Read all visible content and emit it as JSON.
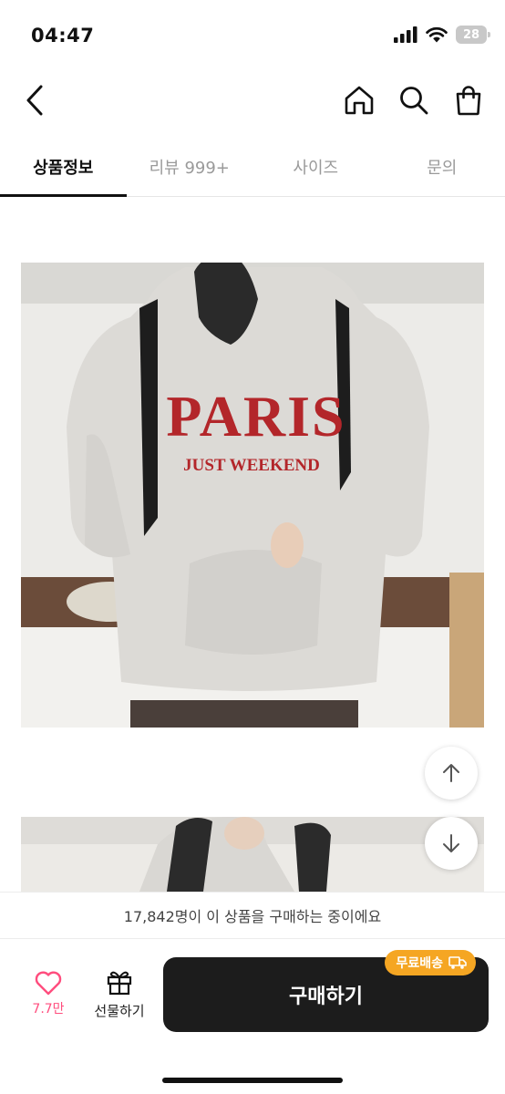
{
  "status_bar": {
    "time": "04:47",
    "battery": "28"
  },
  "tabs": [
    {
      "label": "상품정보",
      "active": true
    },
    {
      "label": "리뷰 999+",
      "active": false
    },
    {
      "label": "사이즈",
      "active": false
    },
    {
      "label": "문의",
      "active": false
    }
  ],
  "product": {
    "print_main": "PARIS",
    "print_sub": "JUST WEEKEND"
  },
  "banner": {
    "text": "17,842명이 이 상품을 구매하는 중이에요"
  },
  "bottom_bar": {
    "like_count": "7.7만",
    "gift_label": "선물하기",
    "buy_label": "구매하기",
    "free_shipping_badge": "무료배송"
  },
  "colors": {
    "accent_pink": "#ff4d7e",
    "badge_orange": "#f5a623",
    "buy_button": "#1c1c1c"
  },
  "icons": [
    "back-icon",
    "home-icon",
    "search-icon",
    "shopping-bag-icon",
    "arrow-up-icon",
    "arrow-down-icon",
    "heart-icon",
    "gift-icon",
    "truck-icon"
  ]
}
